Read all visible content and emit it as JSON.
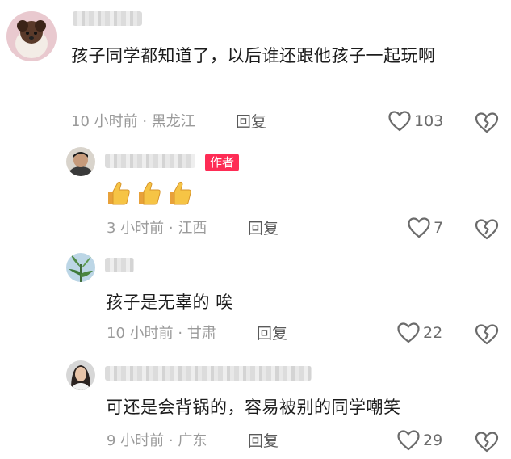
{
  "comments": [
    {
      "author_tag": "",
      "text": "孩子同学都知道了，以后谁还跟他孩子一起玩啊",
      "time": "10 小时前",
      "location": "黑龙江",
      "reply_label": "回复",
      "likes": "103",
      "avatar_icon": "puppy-avatar-icon"
    },
    {
      "author_tag": "作者",
      "text": "👍👍👍",
      "time": "3 小时前",
      "location": "江西",
      "reply_label": "回复",
      "likes": "7",
      "avatar_icon": "man-avatar-icon"
    },
    {
      "author_tag": "",
      "text": "孩子是无辜的 唉",
      "time": "10 小时前",
      "location": "甘肃",
      "reply_label": "回复",
      "likes": "22",
      "avatar_icon": "plant-avatar-icon"
    },
    {
      "author_tag": "",
      "text": "可还是会背锅的，容易被别的同学嘲笑",
      "time": "9 小时前",
      "location": "广东",
      "reply_label": "回复",
      "likes": "29",
      "avatar_icon": "woman-avatar-icon"
    }
  ],
  "colors": {
    "badge": "#fe2c55",
    "meta_text": "#9a9a9a",
    "body_text": "#1c1c1c"
  }
}
